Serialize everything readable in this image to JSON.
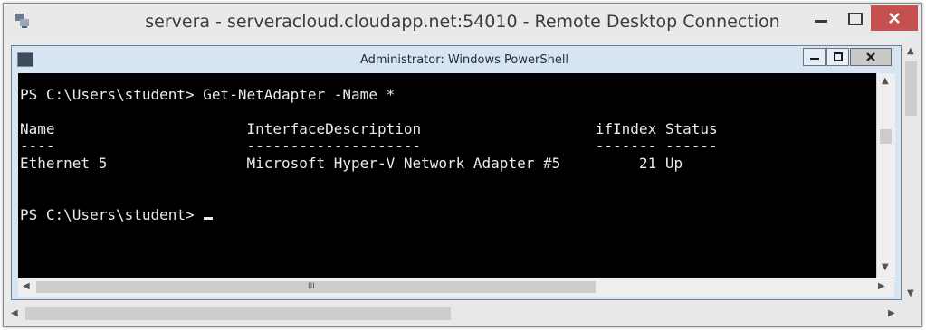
{
  "outer_window": {
    "title": "servera - serveracloud.cloudapp.net:54010 - Remote Desktop Connection",
    "icon": "remote-desktop-icon"
  },
  "ps_window": {
    "title": "Administrator: Windows PowerShell",
    "icon": "powershell-icon"
  },
  "console": {
    "lines": [
      "PS C:\\Users\\student> Get-NetAdapter -Name *",
      "",
      "Name                      InterfaceDescription                    ifIndex Status",
      "----                      --------------------                    ------- ------",
      "Ethernet 5                Microsoft Hyper-V Network Adapter #5         21 Up",
      "",
      "",
      "PS C:\\Users\\student> "
    ]
  },
  "colors": {
    "console_bg": "#000000",
    "console_text": "#eaeaea",
    "close_red": "#c75050"
  }
}
